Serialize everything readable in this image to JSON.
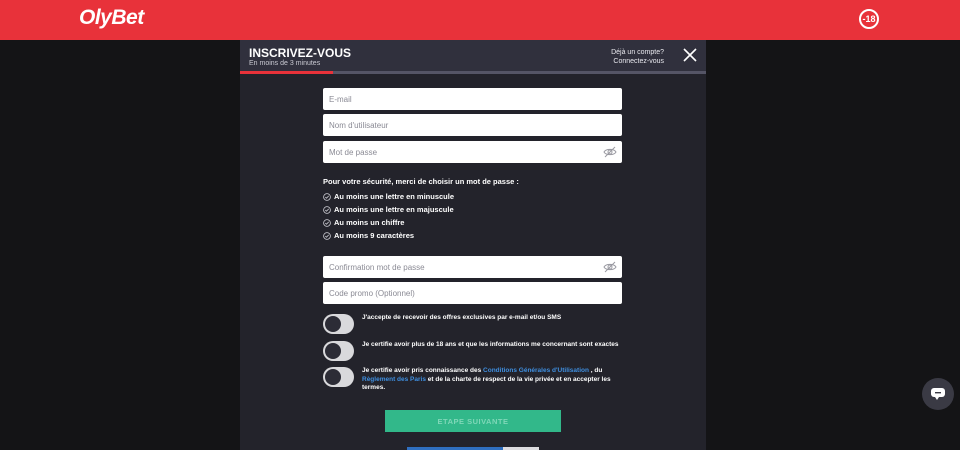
{
  "header": {
    "logo": "OlyBet",
    "age_badge": "-18"
  },
  "modal": {
    "title": "INSCRIVEZ-VOUS",
    "subtitle": "En moins de 3 minutes",
    "progress_fraction": 0.2,
    "account_question": "Déjà un compte?",
    "login_link": "Connectez-vous"
  },
  "form": {
    "email_placeholder": "E-mail",
    "username_placeholder": "Nom d'utilisateur",
    "password_placeholder": "Mot de passe",
    "password_rules_title": "Pour votre sécurité, merci de choisir un mot de passe :",
    "password_rules": [
      "Au moins une lettre en minuscule",
      "Au moins une lettre en majuscule",
      "Au moins un chiffre",
      "Au moins 9 caractères"
    ],
    "confirm_placeholder": "Confirmation mot de passe",
    "promo_placeholder": "Code promo (Optionnel)",
    "consent_offers": "J'accepte de recevoir des offres exclusives par e-mail et/ou SMS",
    "consent_age": "Je certifie avoir plus de 18 ans et que les informations me concernant sont exactes",
    "consent_terms_part1": "Je certifie avoir pris connaissance des ",
    "consent_terms_link1": "Conditions Générales d'Utilisation",
    "consent_terms_part2": " , du ",
    "consent_terms_link2": "Règlement des Paris",
    "consent_terms_part3": " et de la charte de respect de la vie privée et en accepter les termes.",
    "next_button": "ETAPE SUIVANTE"
  },
  "icons": {
    "close": "close-icon",
    "eye": "eye-off-icon",
    "check": "check-circle-icon",
    "chat": "chat-icon"
  },
  "colors": {
    "brand_red": "#e8323a",
    "modal_bg": "#23232b",
    "button_green": "#32b88a",
    "link_blue": "#3f8fe0"
  }
}
